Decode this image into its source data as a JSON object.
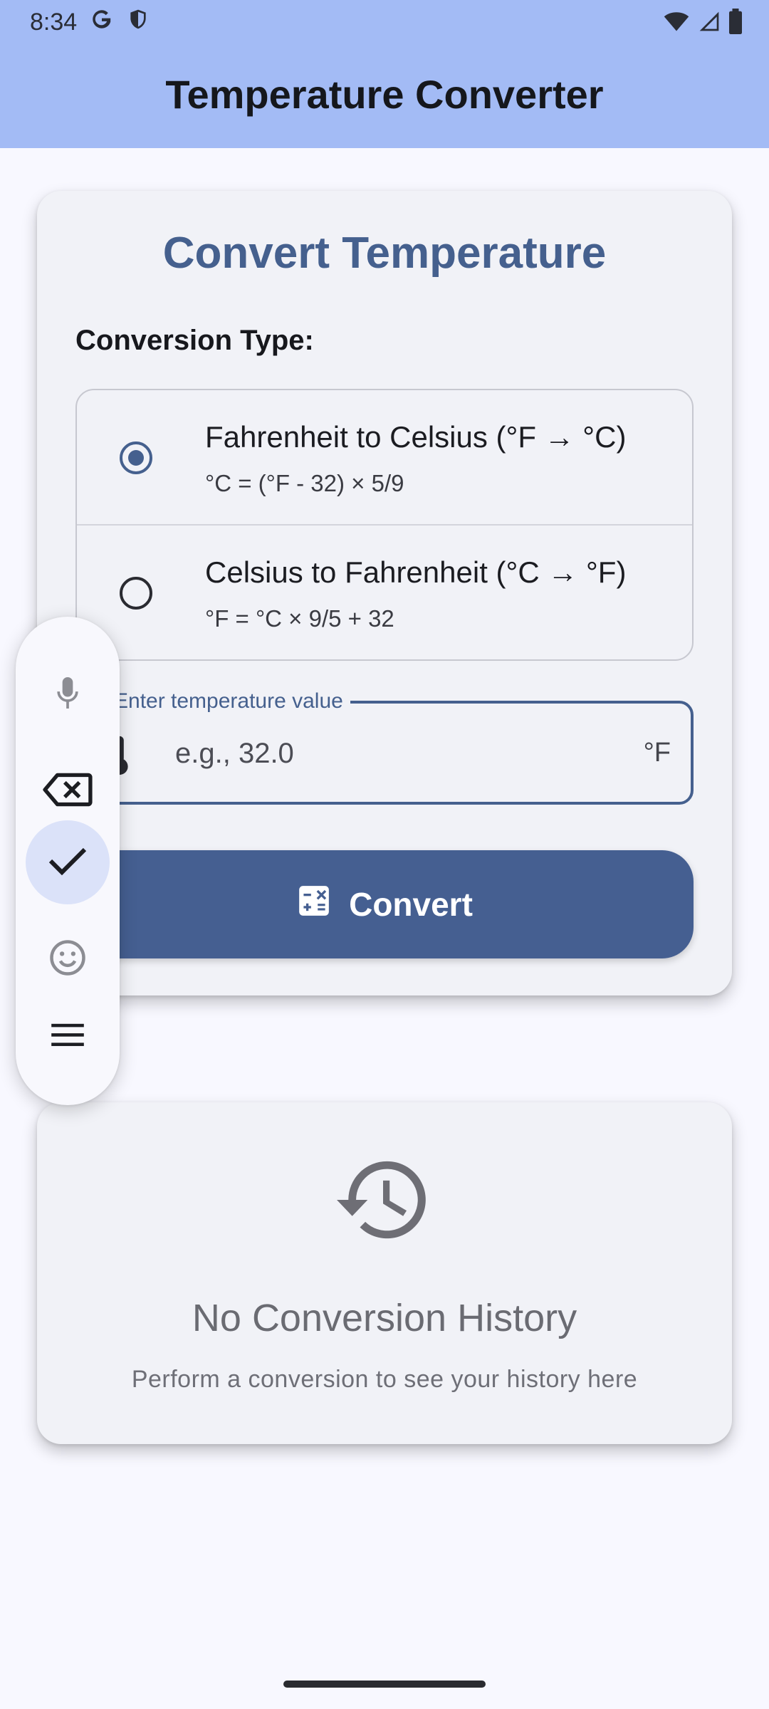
{
  "status_bar": {
    "time": "8:34",
    "icons": [
      "google-icon",
      "shield-icon",
      "wifi-icon",
      "signal-icon",
      "battery-icon"
    ]
  },
  "app_bar": {
    "title": "Temperature Converter"
  },
  "converter": {
    "title": "Convert Temperature",
    "conversion_type_label": "Conversion Type:",
    "options": [
      {
        "label": "Fahrenheit to Celsius (°F → °C)",
        "formula": "°C = (°F - 32) × 5/9",
        "selected": true
      },
      {
        "label": "Celsius to Fahrenheit (°C → °F)",
        "formula": "°F = °C × 9/5 + 32",
        "selected": false
      }
    ],
    "input": {
      "label": "Enter temperature value",
      "placeholder": "e.g., 32.0",
      "value": "",
      "unit": "°F",
      "icon": "thermometer-icon"
    },
    "convert_button": {
      "label": "Convert",
      "icon": "calculator-icon"
    }
  },
  "history": {
    "icon": "history-icon",
    "empty_title": "No Conversion History",
    "empty_subtitle": "Perform a conversion to see your history here"
  },
  "floating_toolbar": {
    "items": [
      {
        "name": "microphone-icon",
        "active": false
      },
      {
        "name": "backspace-icon",
        "active": false
      },
      {
        "name": "check-icon",
        "active": true
      },
      {
        "name": "emoji-icon",
        "active": false
      },
      {
        "name": "menu-icon",
        "active": false
      }
    ]
  },
  "colors": {
    "app_bar": "#a3bbf5",
    "primary": "#45608e",
    "background": "#f8f8ff",
    "card": "#f1f2f7",
    "toolbar_active": "#dbe2f9"
  }
}
